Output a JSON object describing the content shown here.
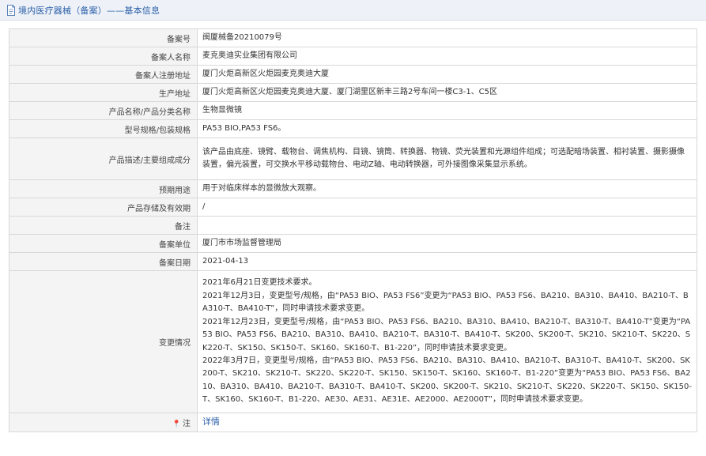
{
  "header": {
    "icon": "document-icon",
    "title": "境内医疗器械（备案）——基本信息",
    "accent_color": "#2a5fa8"
  },
  "rows": [
    {
      "label": "备案号",
      "value": "闽厦械备20210079号"
    },
    {
      "label": "备案人名称",
      "value": "麦克奥迪实业集团有限公司"
    },
    {
      "label": "备案人注册地址",
      "value": "厦门火炬高新区火炬园麦克奥迪大厦"
    },
    {
      "label": "生产地址",
      "value": "厦门火炬高新区火炬园麦克奥迪大厦、厦门湖里区新丰三路2号车间一楼C3-1、C5区"
    },
    {
      "label": "产品名称/产品分类名称",
      "value": "生物显微镜"
    },
    {
      "label": "型号规格/包装规格",
      "value": "PA53 BIO,PA53 FS6。"
    },
    {
      "label": "产品描述/主要组成成分",
      "value": "该产品由底座、镜臂、载物台、调焦机构、目镜、镜筒、转换器、物镜、荧光装置和光源组件组成；可选配暗场装置、相衬装置、摄影摄像装置，偏光装置，可交换水平移动载物台、电动Z轴、电动转换器，可外接图像采集显示系统。"
    },
    {
      "label": "预期用途",
      "value": "用于对临床样本的显微放大观察。"
    },
    {
      "label": "产品存储及有效期",
      "value": "/"
    },
    {
      "label": "备注",
      "value": ""
    },
    {
      "label": "备案单位",
      "value": "厦门市市场监督管理局"
    },
    {
      "label": "备案日期",
      "value": "2021-04-13"
    }
  ],
  "changes": {
    "label": "变更情况",
    "lines": [
      "2021年6月21日变更技术要求。",
      "2021年12月3日，变更型号/规格，由“PA53 BIO、PA53 FS6”变更为“PA53 BIO、PA53 FS6、BA210、BA310、BA410、BA210-T、BA310-T、BA410-T”，同时申请技术要求变更。",
      "2021年12月23日，变更型号/规格，由“PA53 BIO、PA53 FS6、BA210、BA310、BA410、BA210-T、BA310-T、BA410-T”变更为“PA53 BIO、PA53 FS6、BA210、BA310、BA410、BA210-T、BA310-T、BA410-T、SK200、SK200-T、SK210、SK210-T、SK220、SK220-T、SK150、SK150-T、SK160、SK160-T、B1-220”，同时申请技术要求变更。",
      "2022年3月7日，变更型号/规格，由“PA53 BIO、PA53 FS6、BA210、BA310、BA410、BA210-T、BA310-T、BA410-T、SK200、SK200-T、SK210、SK210-T、SK220、SK220-T、SK150、SK150-T、SK160、SK160-T、B1-220”变更为“PA53 BIO、PA53 FS6、BA210、BA310、BA410、BA210-T、BA310-T、BA410-T、SK200、SK200-T、SK210、SK210-T、SK220、SK220-T、SK150、SK150-T、SK160、SK160-T、B1-220、AE30、AE31、AE31E、AE2000、AE2000T”，同时申请技术要求变更。"
    ]
  },
  "note_row": {
    "icon": "pin-icon",
    "label": "注",
    "link_text": "详情"
  }
}
